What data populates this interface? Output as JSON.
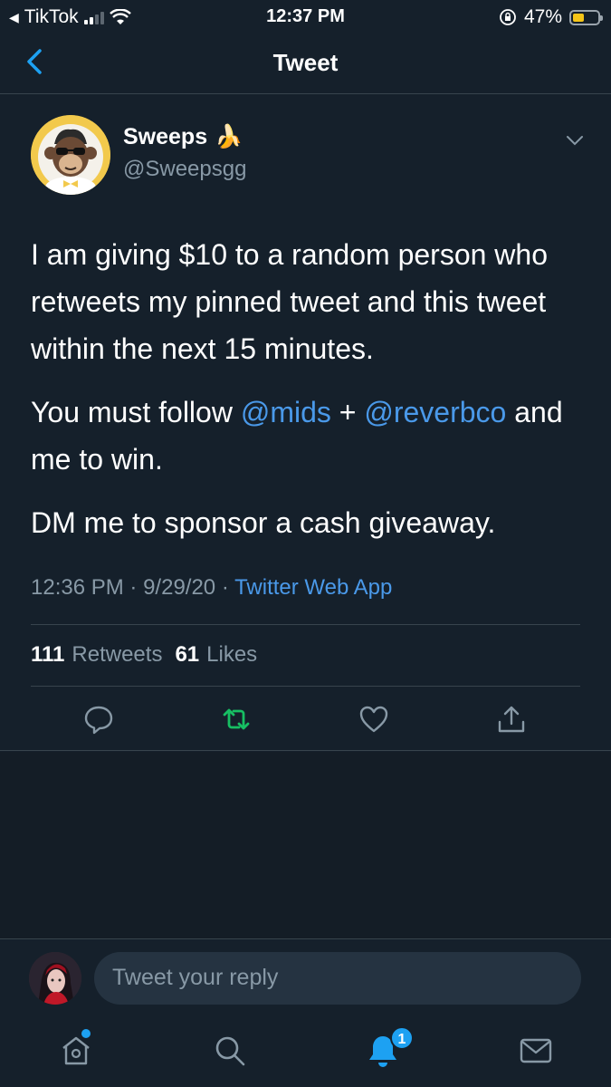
{
  "status_bar": {
    "back_app": "TikTok",
    "time": "12:37 PM",
    "battery_percent": "47%",
    "battery_level": 0.47
  },
  "header": {
    "title": "Tweet"
  },
  "tweet": {
    "display_name": "Sweeps",
    "emoji": "🍌",
    "handle": "@Sweepsgg",
    "paragraph1": "I am giving $10 to a random person who retweets my pinned tweet and this tweet within the next 15 minutes.",
    "p2_before": "You must follow ",
    "mention1": "@mids",
    "p2_plus": " + ",
    "mention2": "@reverbco",
    "p2_after": " and me to win.",
    "paragraph3": "DM me to sponsor a cash giveaway.",
    "time": "12:36 PM",
    "date": "9/29/20",
    "separator": "·",
    "source": "Twitter Web App",
    "retweet_count": "111",
    "retweet_label": "Retweets",
    "like_count": "61",
    "like_label": "Likes"
  },
  "reply": {
    "placeholder": "Tweet your reply"
  },
  "tabs": {
    "notification_badge": "1"
  },
  "colors": {
    "background": "#15202b",
    "accent": "#1da1f2",
    "link": "#4a99e9",
    "retweet_green": "#17bf63",
    "secondary_text": "#8899a6"
  }
}
